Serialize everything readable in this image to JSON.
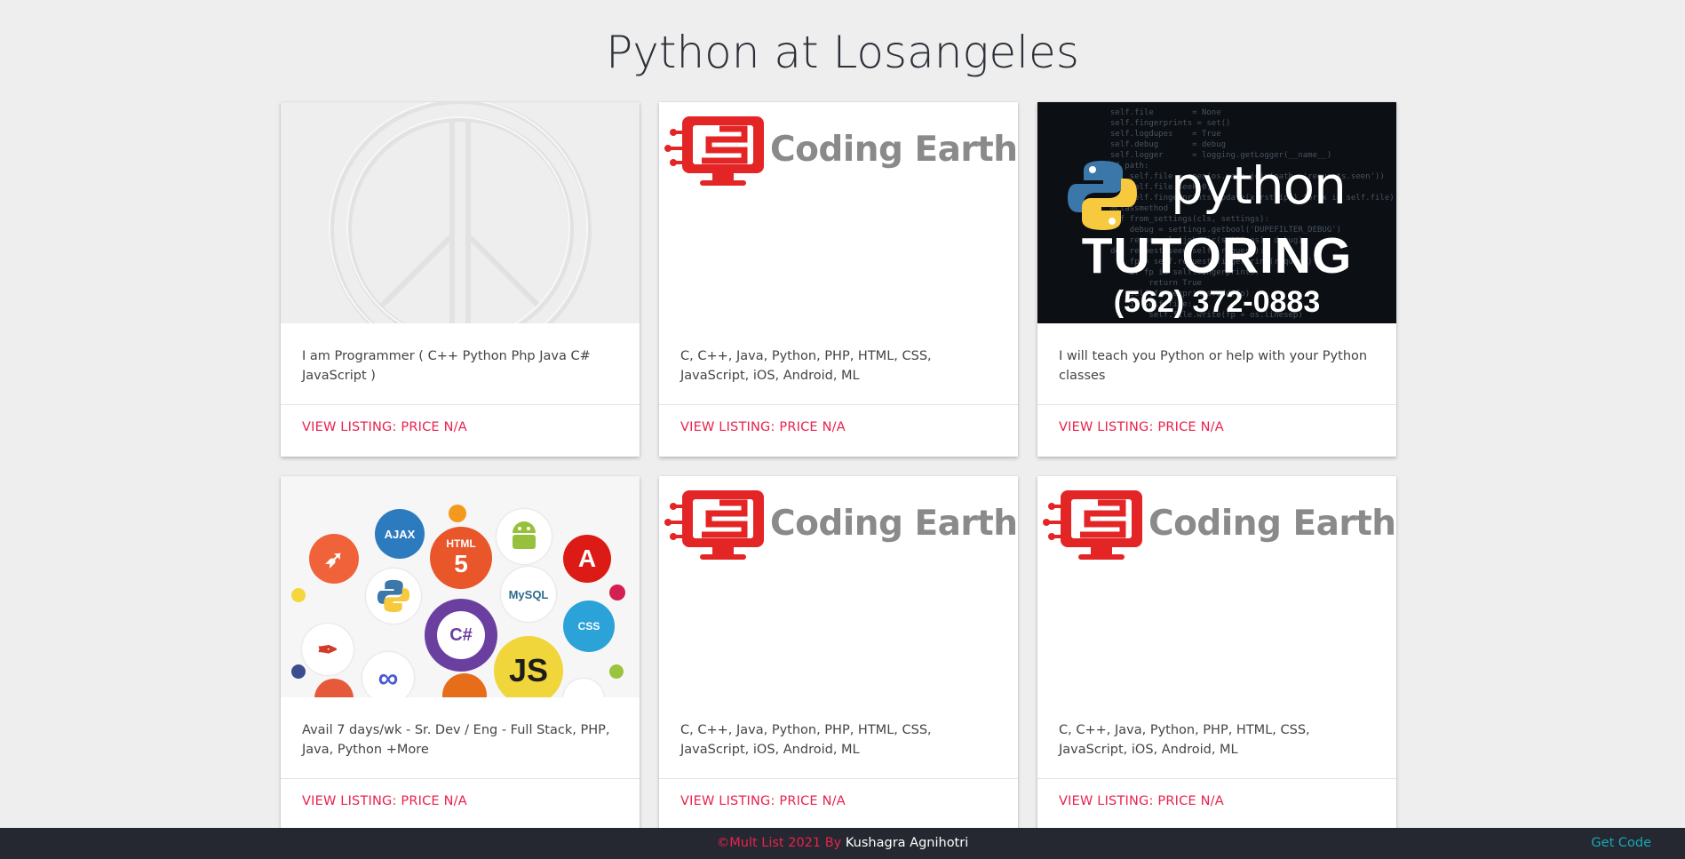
{
  "page": {
    "title": "Python at Losangeles"
  },
  "listings": [
    {
      "media": "peace-sign-emboss",
      "description": "I am Programmer ( C++ Python Php Java C# JavaScript )",
      "action": "VIEW LISTING: PRICE N/A"
    },
    {
      "media": "coding-earth-logo",
      "logo_text": "Coding Earth",
      "description": "C, C++, Java, Python, PHP, HTML, CSS, JavaScript, iOS, Android, ML",
      "action": "VIEW LISTING: PRICE N/A"
    },
    {
      "media": "python-tutoring-banner",
      "banner_title": "python",
      "banner_subtitle": "TUTORING",
      "banner_phone": "(562) 372-0883",
      "description": "I will teach you Python or help with your Python classes",
      "action": "VIEW LISTING: PRICE N/A"
    },
    {
      "media": "tech-logos-collage",
      "collage_labels": {
        "ajax": "AJAX",
        "html": "HTML",
        "angular": "A",
        "mysql": "MySQL",
        "css": "CSS",
        "csharp": "C#",
        "js": "JS"
      },
      "description": "Avail 7 days/wk - Sr. Dev / Eng - Full Stack, PHP, Java, Python +More",
      "action": "VIEW LISTING: PRICE N/A"
    },
    {
      "media": "coding-earth-logo",
      "logo_text": "Coding Earth",
      "description": "C, C++, Java, Python, PHP, HTML, CSS, JavaScript, iOS, Android, ML",
      "action": "VIEW LISTING: PRICE N/A"
    },
    {
      "media": "coding-earth-logo",
      "logo_text": "Coding Earth",
      "description": "C, C++, Java, Python, PHP, HTML, CSS, JavaScript, iOS, Android, ML",
      "action": "VIEW LISTING: PRICE N/A"
    }
  ],
  "footer": {
    "copyright": "©Mult List 2021 By ",
    "author": "Kushagra Agnihotri",
    "link": "Get Code"
  },
  "colors": {
    "accent": "#e9224d",
    "footer_bg": "#252830",
    "link": "#17a8b8",
    "background": "#eeeeee"
  }
}
